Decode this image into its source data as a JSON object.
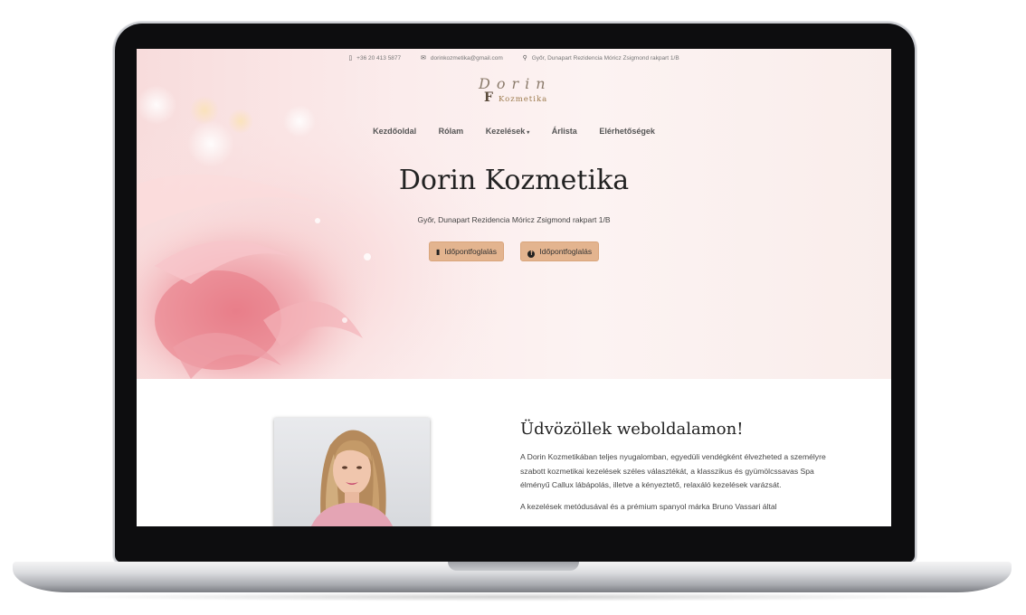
{
  "topbar": {
    "phone": "+36 20 413 5877",
    "email": "dorinkozmetika@gmail.com",
    "address": "Győr, Dunapart Rezidencia Móricz Zsigmond rakpart 1/B"
  },
  "logo": {
    "script": "Dorin",
    "mark": "F",
    "subtitle": "Kozmetika"
  },
  "nav": {
    "items": [
      "Kezdőoldal",
      "Rólam",
      "Kezelések",
      "Árlista",
      "Elérhetőségek"
    ],
    "dropdown_caret": "▾"
  },
  "hero": {
    "title": "Dorin Kozmetika",
    "address": "Győr, Dunapart Rezidencia Móricz Zsigmond rakpart 1/B",
    "buttons": [
      {
        "label": "Időpontfoglalás",
        "icon": "phone-icon"
      },
      {
        "label": "Időpontfoglalás",
        "icon": "facebook-icon"
      }
    ]
  },
  "welcome": {
    "title": "Üdvözöllek weboldalamon!",
    "paragraph1": "A Dorin Kozmetikában teljes nyugalomban, egyedüli vendégként élvezheted a személyre szabott kozmetikai kezelések széles választékát, a klasszikus és gyümölcssavas Spa élményű Callux lábápolás, illetve a kényeztető, relaxáló kezelések varázsát.",
    "paragraph2": "A kezelések metódusával és a prémium spanyol márka Bruno Vassari által"
  },
  "colors": {
    "button_bg": "#e3b48f",
    "accent_brown": "#9c7a4c",
    "hero_pink": "#f8dcdc"
  }
}
